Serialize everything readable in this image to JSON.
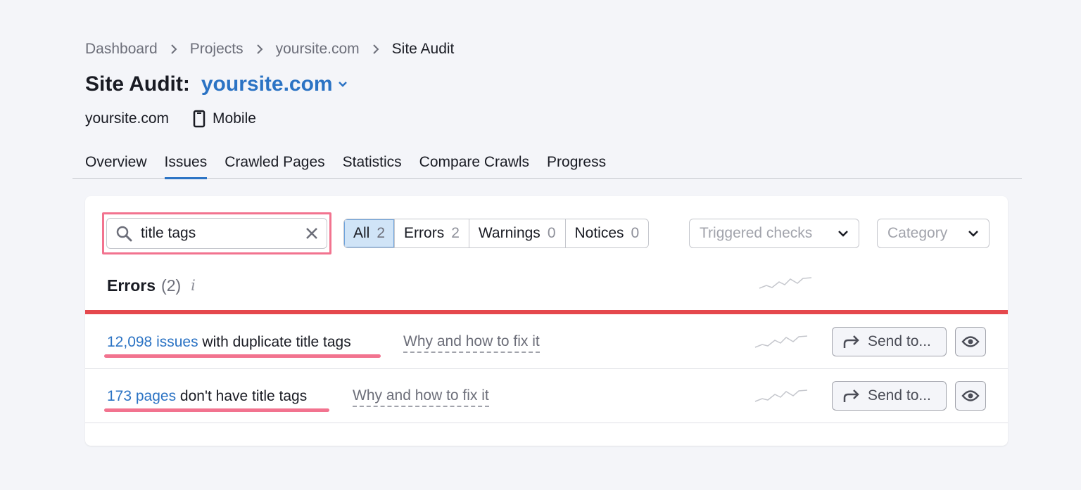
{
  "breadcrumb": {
    "items": [
      "Dashboard",
      "Projects",
      "yoursite.com",
      "Site Audit"
    ]
  },
  "header": {
    "title_prefix": "Site Audit:",
    "project": "yoursite.com",
    "domain": "yoursite.com",
    "device": "Mobile"
  },
  "tabs": [
    {
      "label": "Overview"
    },
    {
      "label": "Issues"
    },
    {
      "label": "Crawled Pages"
    },
    {
      "label": "Statistics"
    },
    {
      "label": "Compare Crawls"
    },
    {
      "label": "Progress"
    }
  ],
  "active_tab": "Issues",
  "search": {
    "value": "title tags"
  },
  "filters": [
    {
      "label": "All",
      "count": "2"
    },
    {
      "label": "Errors",
      "count": "2"
    },
    {
      "label": "Warnings",
      "count": "0"
    },
    {
      "label": "Notices",
      "count": "0"
    }
  ],
  "dropdowns": {
    "triggered": "Triggered checks",
    "category": "Category"
  },
  "section": {
    "title": "Errors",
    "count": "(2)",
    "info": "i"
  },
  "issues": [
    {
      "link": "12,098 issues",
      "text": " with duplicate title tags",
      "why": "Why and how to fix it",
      "send": "Send to..."
    },
    {
      "link": "173 pages",
      "text": " don't have title tags",
      "why": "Why and how to fix it",
      "send": "Send to..."
    }
  ],
  "colors": {
    "accent": "#2b73c4",
    "error": "#e5484d",
    "highlight": "#f2738f"
  }
}
